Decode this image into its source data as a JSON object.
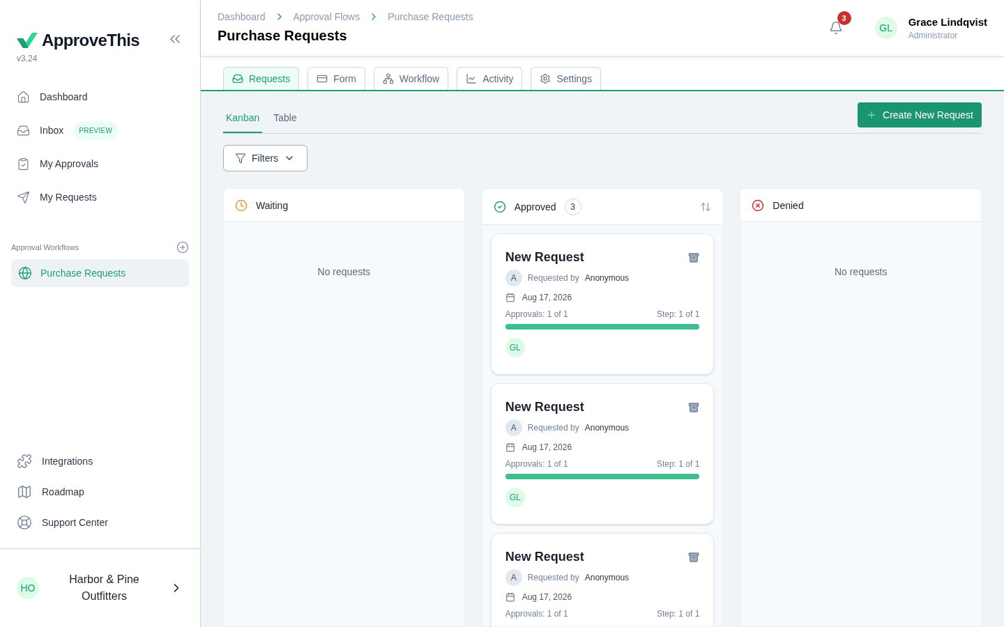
{
  "brand": {
    "name": "ApproveThis",
    "version": "v3.24"
  },
  "nav": [
    {
      "label": "Dashboard"
    },
    {
      "label": "Inbox",
      "badge": "PREVIEW"
    },
    {
      "label": "My Approvals"
    },
    {
      "label": "My Requests"
    }
  ],
  "workflows": {
    "heading": "Approval Workflows",
    "items": [
      {
        "label": "Purchase Requests",
        "selected": true
      }
    ]
  },
  "footer_nav": [
    {
      "label": "Integrations"
    },
    {
      "label": "Roadmap"
    },
    {
      "label": "Support Center"
    }
  ],
  "org": {
    "initials": "HO",
    "name": "Harbor & Pine Outfitters"
  },
  "breadcrumbs": [
    "Dashboard",
    "Approval Flows",
    "Purchase Requests"
  ],
  "page_title": "Purchase Requests",
  "notifications": {
    "count": "3"
  },
  "user": {
    "initials": "GL",
    "name": "Grace Lindqvist",
    "role": "Administrator"
  },
  "tabs": [
    {
      "label": "Requests",
      "selected": true
    },
    {
      "label": "Form",
      "selected": false
    },
    {
      "label": "Workflow",
      "selected": false
    },
    {
      "label": "Activity",
      "selected": false
    },
    {
      "label": "Settings",
      "selected": false
    }
  ],
  "views": [
    {
      "label": "Kanban",
      "selected": true
    },
    {
      "label": "Table",
      "selected": false
    }
  ],
  "create_button": "Create New Request",
  "filters_button": "Filters",
  "columns": [
    {
      "title": "Waiting",
      "kind": "waiting",
      "empty_text": "No requests"
    },
    {
      "title": "Approved",
      "kind": "approved",
      "count": "3",
      "cards": [
        {
          "title": "New Request",
          "requester_initial": "A",
          "requested_by": "Requested by",
          "requester": "Anonymous",
          "date": "Aug 17, 2026",
          "approvals": "Approvals: 1 of 1",
          "step": "Step: 1 of 1",
          "level": 1,
          "approver": "GL"
        },
        {
          "title": "New Request",
          "requester_initial": "A",
          "requested_by": "Requested by",
          "requester": "Anonymous",
          "date": "Aug 17, 2026",
          "approvals": "Approvals: 1 of 1",
          "step": "Step: 1 of 1",
          "level": 1,
          "approver": "GL"
        },
        {
          "title": "New Request",
          "requester_initial": "A",
          "requested_by": "Requested by",
          "requester": "Anonymous",
          "date": "Aug 17, 2026",
          "approvals": "Approvals: 1 of 1",
          "step": "Step: 1 of 1"
        }
      ]
    },
    {
      "title": "Denied",
      "kind": "denied",
      "empty_text": "No requests"
    }
  ]
}
